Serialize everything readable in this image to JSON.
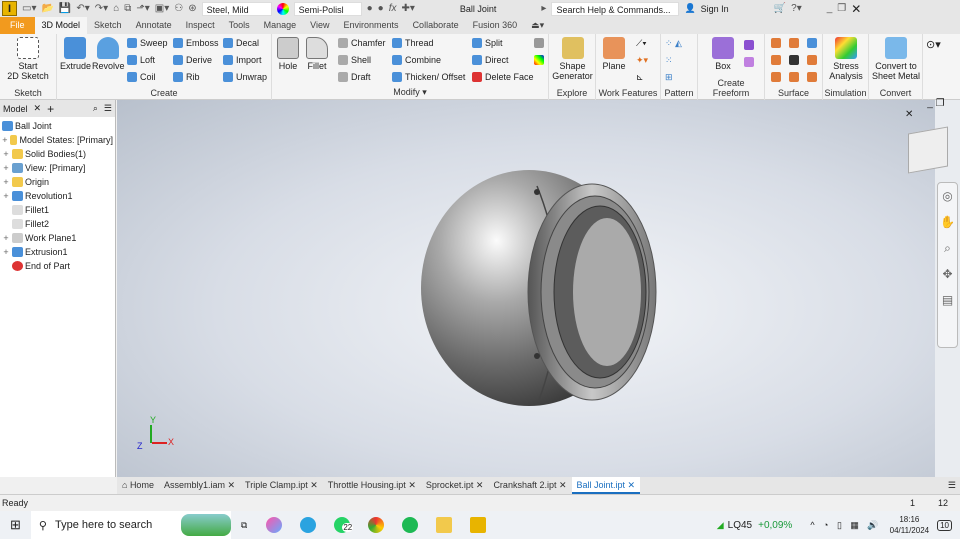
{
  "qat": {
    "material": "Steel, Mild",
    "appearance": "Semi-Polisl",
    "doc_title": "Ball Joint",
    "search_placeholder": "Search Help & Commands...",
    "sign_in": "Sign In",
    "logo": "I",
    "fx": "fx"
  },
  "tabs": [
    "File",
    "3D Model",
    "Sketch",
    "Annotate",
    "Inspect",
    "Tools",
    "Manage",
    "View",
    "Environments",
    "Collaborate",
    "Fusion 360"
  ],
  "ribbon": {
    "sketch": {
      "title": "Sketch",
      "start": "Start",
      "start2": "2D Sketch"
    },
    "create": {
      "title": "Create",
      "extrude": "Extrude",
      "revolve": "Revolve",
      "items": [
        "Sweep",
        "Loft",
        "Coil",
        "Emboss",
        "Derive",
        "Rib",
        "Decal",
        "Import",
        "Unwrap"
      ]
    },
    "modify": {
      "title": "Modify ▾",
      "hole": "Hole",
      "fillet": "Fillet",
      "items": [
        "Chamfer",
        "Shell",
        "Draft",
        "Thread",
        "Combine",
        "Thicken/ Offset",
        "Split",
        "Direct",
        "Delete Face"
      ]
    },
    "explore": {
      "title": "Explore",
      "l1": "Shape",
      "l2": "Generator"
    },
    "work": {
      "title": "Work Features",
      "plane": "Plane"
    },
    "pattern": {
      "title": "Pattern"
    },
    "freeform": {
      "title": "Create Freeform",
      "box": "Box"
    },
    "surface": {
      "title": "Surface"
    },
    "simulation": {
      "title": "Simulation",
      "l1": "Stress",
      "l2": "Analysis"
    },
    "convert": {
      "title": "Convert",
      "l1": "Convert to",
      "l2": "Sheet Metal"
    }
  },
  "browser": {
    "tab": "Model",
    "nodes": [
      {
        "label": "Ball Joint",
        "exp": ""
      },
      {
        "label": "Model States: [Primary]",
        "exp": "+"
      },
      {
        "label": "Solid Bodies(1)",
        "exp": "+"
      },
      {
        "label": "View: [Primary]",
        "exp": "+"
      },
      {
        "label": "Origin",
        "exp": "+"
      },
      {
        "label": "Revolution1",
        "exp": "+"
      },
      {
        "label": "Fillet1",
        "exp": ""
      },
      {
        "label": "Fillet2",
        "exp": ""
      },
      {
        "label": "Work Plane1",
        "exp": "+"
      },
      {
        "label": "Extrusion1",
        "exp": "+"
      },
      {
        "label": "End of Part",
        "exp": ""
      }
    ]
  },
  "axes": {
    "x": "X",
    "y": "Y",
    "z": "Z"
  },
  "doc_tabs": [
    "Home",
    "Assembly1.iam",
    "Triple Clamp.ipt",
    "Throttle Housing.ipt",
    "Sprocket.ipt",
    "Crankshaft 2.ipt",
    "Ball Joint.ipt"
  ],
  "status": {
    "text": "Ready",
    "n1": "1",
    "n2": "12"
  },
  "taskbar": {
    "search": "Type here to search",
    "whatsapp_badge": "22",
    "stock": "LQ45",
    "change": "+0,09%",
    "time": "18:16",
    "date": "04/11/2024",
    "notif": "10"
  }
}
